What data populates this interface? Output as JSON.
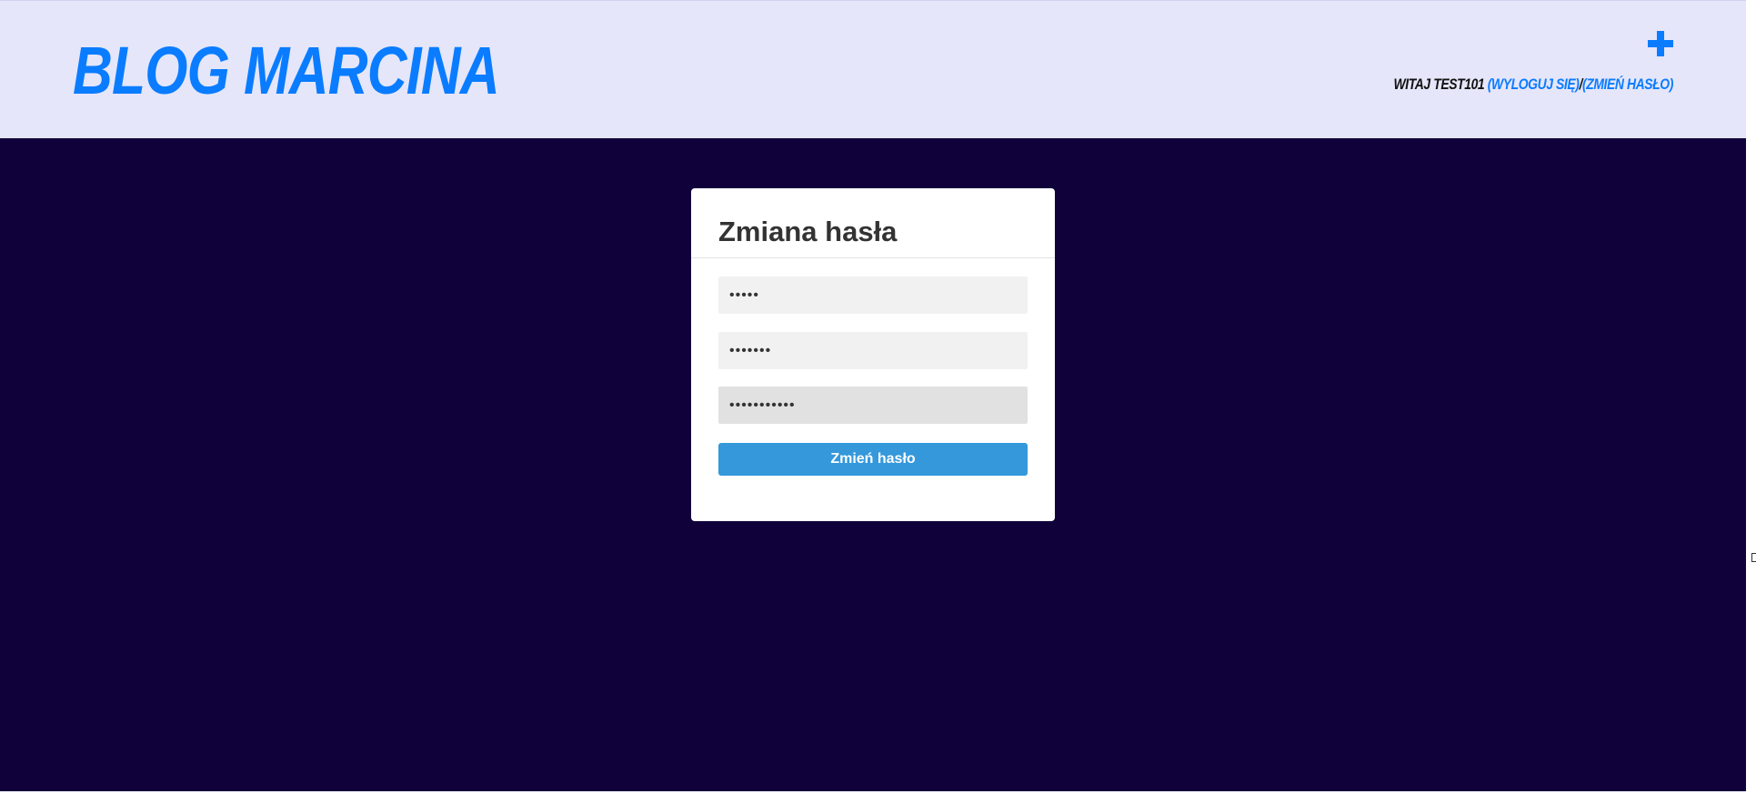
{
  "header": {
    "logo": "Blog Marcina",
    "add_icon": "plus-icon",
    "greeting": "Witaj test101 ",
    "logout_link": "(Wyloguj się)",
    "separator": "/",
    "change_password_link": "(Zmień hasło)"
  },
  "form": {
    "title": "Zmiana hasła",
    "current_password_value": "12345",
    "new_password_value": "1234567",
    "confirm_password_value": "12345678901",
    "submit_label": "Zmień hasło"
  },
  "colors": {
    "header_bg": "#e5e6f9",
    "page_bg": "#10013a",
    "accent": "#0a7cff",
    "button": "#3498db"
  }
}
